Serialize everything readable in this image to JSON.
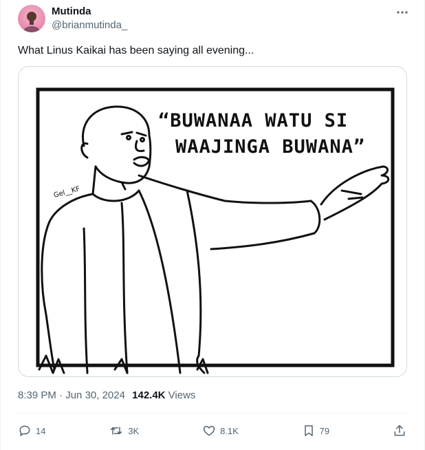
{
  "author": {
    "name": "Mutinda",
    "handle": "@brianmutinda_",
    "avatar_icon": "profile-avatar"
  },
  "tweet": {
    "text": "What Linus Kaikai has been saying all evening...",
    "image": {
      "quote_line1": "“BUWANAA WATU SI",
      "quote_line2": "WAAJINGA BUWANA”",
      "signature": "Gel__KF"
    },
    "time": "8:39 PM",
    "separator": " · ",
    "date": "Jun 30, 2024",
    "views_count": "142.4K",
    "views_label": " Views"
  },
  "actions": {
    "replies": "14",
    "reposts": "3K",
    "likes": "8.1K",
    "bookmarks": "79"
  },
  "icons": {
    "more": "more-icon",
    "reply": "reply-icon",
    "repost": "repost-icon",
    "like": "heart-icon",
    "bookmark": "bookmark-icon",
    "share": "share-icon"
  },
  "colors": {
    "text_primary": "#0f1419",
    "text_secondary": "#536471",
    "border": "#cfd9de"
  }
}
